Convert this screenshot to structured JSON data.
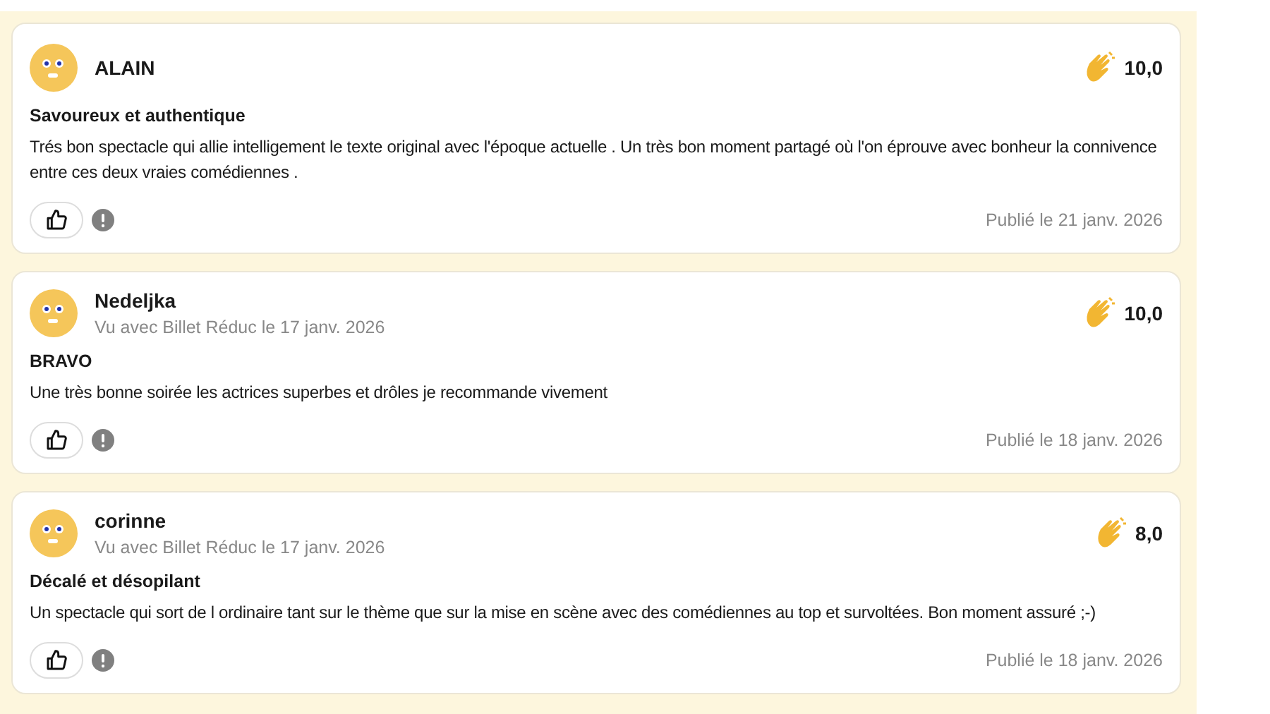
{
  "reviews": [
    {
      "author": "ALAIN",
      "score": "10,0",
      "title": "Savoureux et authentique",
      "text": "Trés bon spectacle qui allie intelligement le texte original avec l'époque actuelle . Un très bon moment partagé où l'on éprouve avec bonheur la connivence entre ces deux vraies comédiennes .",
      "published": "Publié le 21 janv. 2026"
    },
    {
      "author": "Nedeljka",
      "seen": "Vu avec Billet Réduc le 17 janv. 2026",
      "score": "10,0",
      "title": "BRAVO",
      "text": "Une très bonne soirée les actrices superbes et drôles je recommande vivement",
      "published": "Publié le 18 janv. 2026"
    },
    {
      "author": "corinne",
      "seen": "Vu avec Billet Réduc le 17 janv. 2026",
      "score": "8,0",
      "title": "Décalé et désopilant",
      "text": "Un spectacle qui sort de l ordinaire tant sur le thème que sur la mise en scène avec des comédiennes au top et survoltées. Bon moment assuré ;-)",
      "published": "Publié le 18 janv. 2026"
    }
  ]
}
